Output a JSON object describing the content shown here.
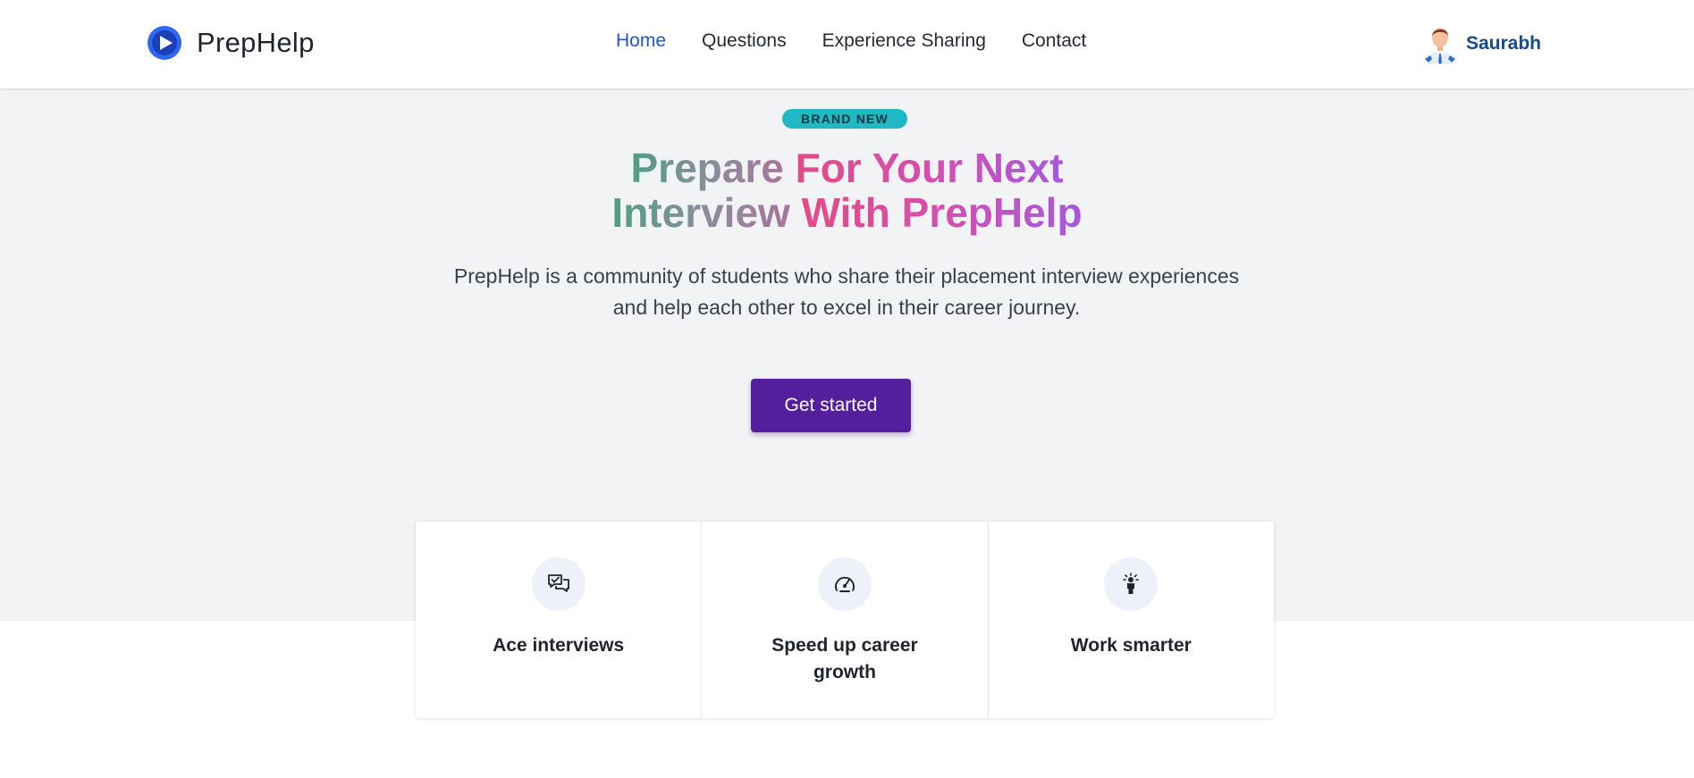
{
  "header": {
    "brand": "PrepHelp",
    "logo_icon": "play-circle-icon",
    "nav": [
      {
        "label": "Home",
        "active": true
      },
      {
        "label": "Questions",
        "active": false
      },
      {
        "label": "Experience Sharing",
        "active": false
      },
      {
        "label": "Contact",
        "active": false
      }
    ],
    "user": {
      "name": "Saurabh",
      "avatar_icon": "user-avatar-icon"
    }
  },
  "hero": {
    "badge": "BRAND NEW",
    "title_line1_a": "Prepare ",
    "title_line1_b": "For Your Next",
    "title_line2_a": "Interview ",
    "title_line2_b": "With PrepHelp",
    "description": "PrepHelp is a community of students who share their placement interview experiences and help each other to excel in their career journey.",
    "cta_label": "Get started"
  },
  "features": [
    {
      "title": "Ace interviews",
      "icon": "chat-bubbles-icon"
    },
    {
      "title": "Speed up career growth",
      "icon": "speedometer-icon"
    },
    {
      "title": "Work smarter",
      "icon": "person-idea-icon"
    }
  ],
  "colors": {
    "accent_nav": "#2553d6",
    "cta_bg": "#531f9c",
    "badge_bg": "#1fb8c4",
    "user_name": "#154a8c",
    "hero_bg": "#f2f3f5"
  }
}
